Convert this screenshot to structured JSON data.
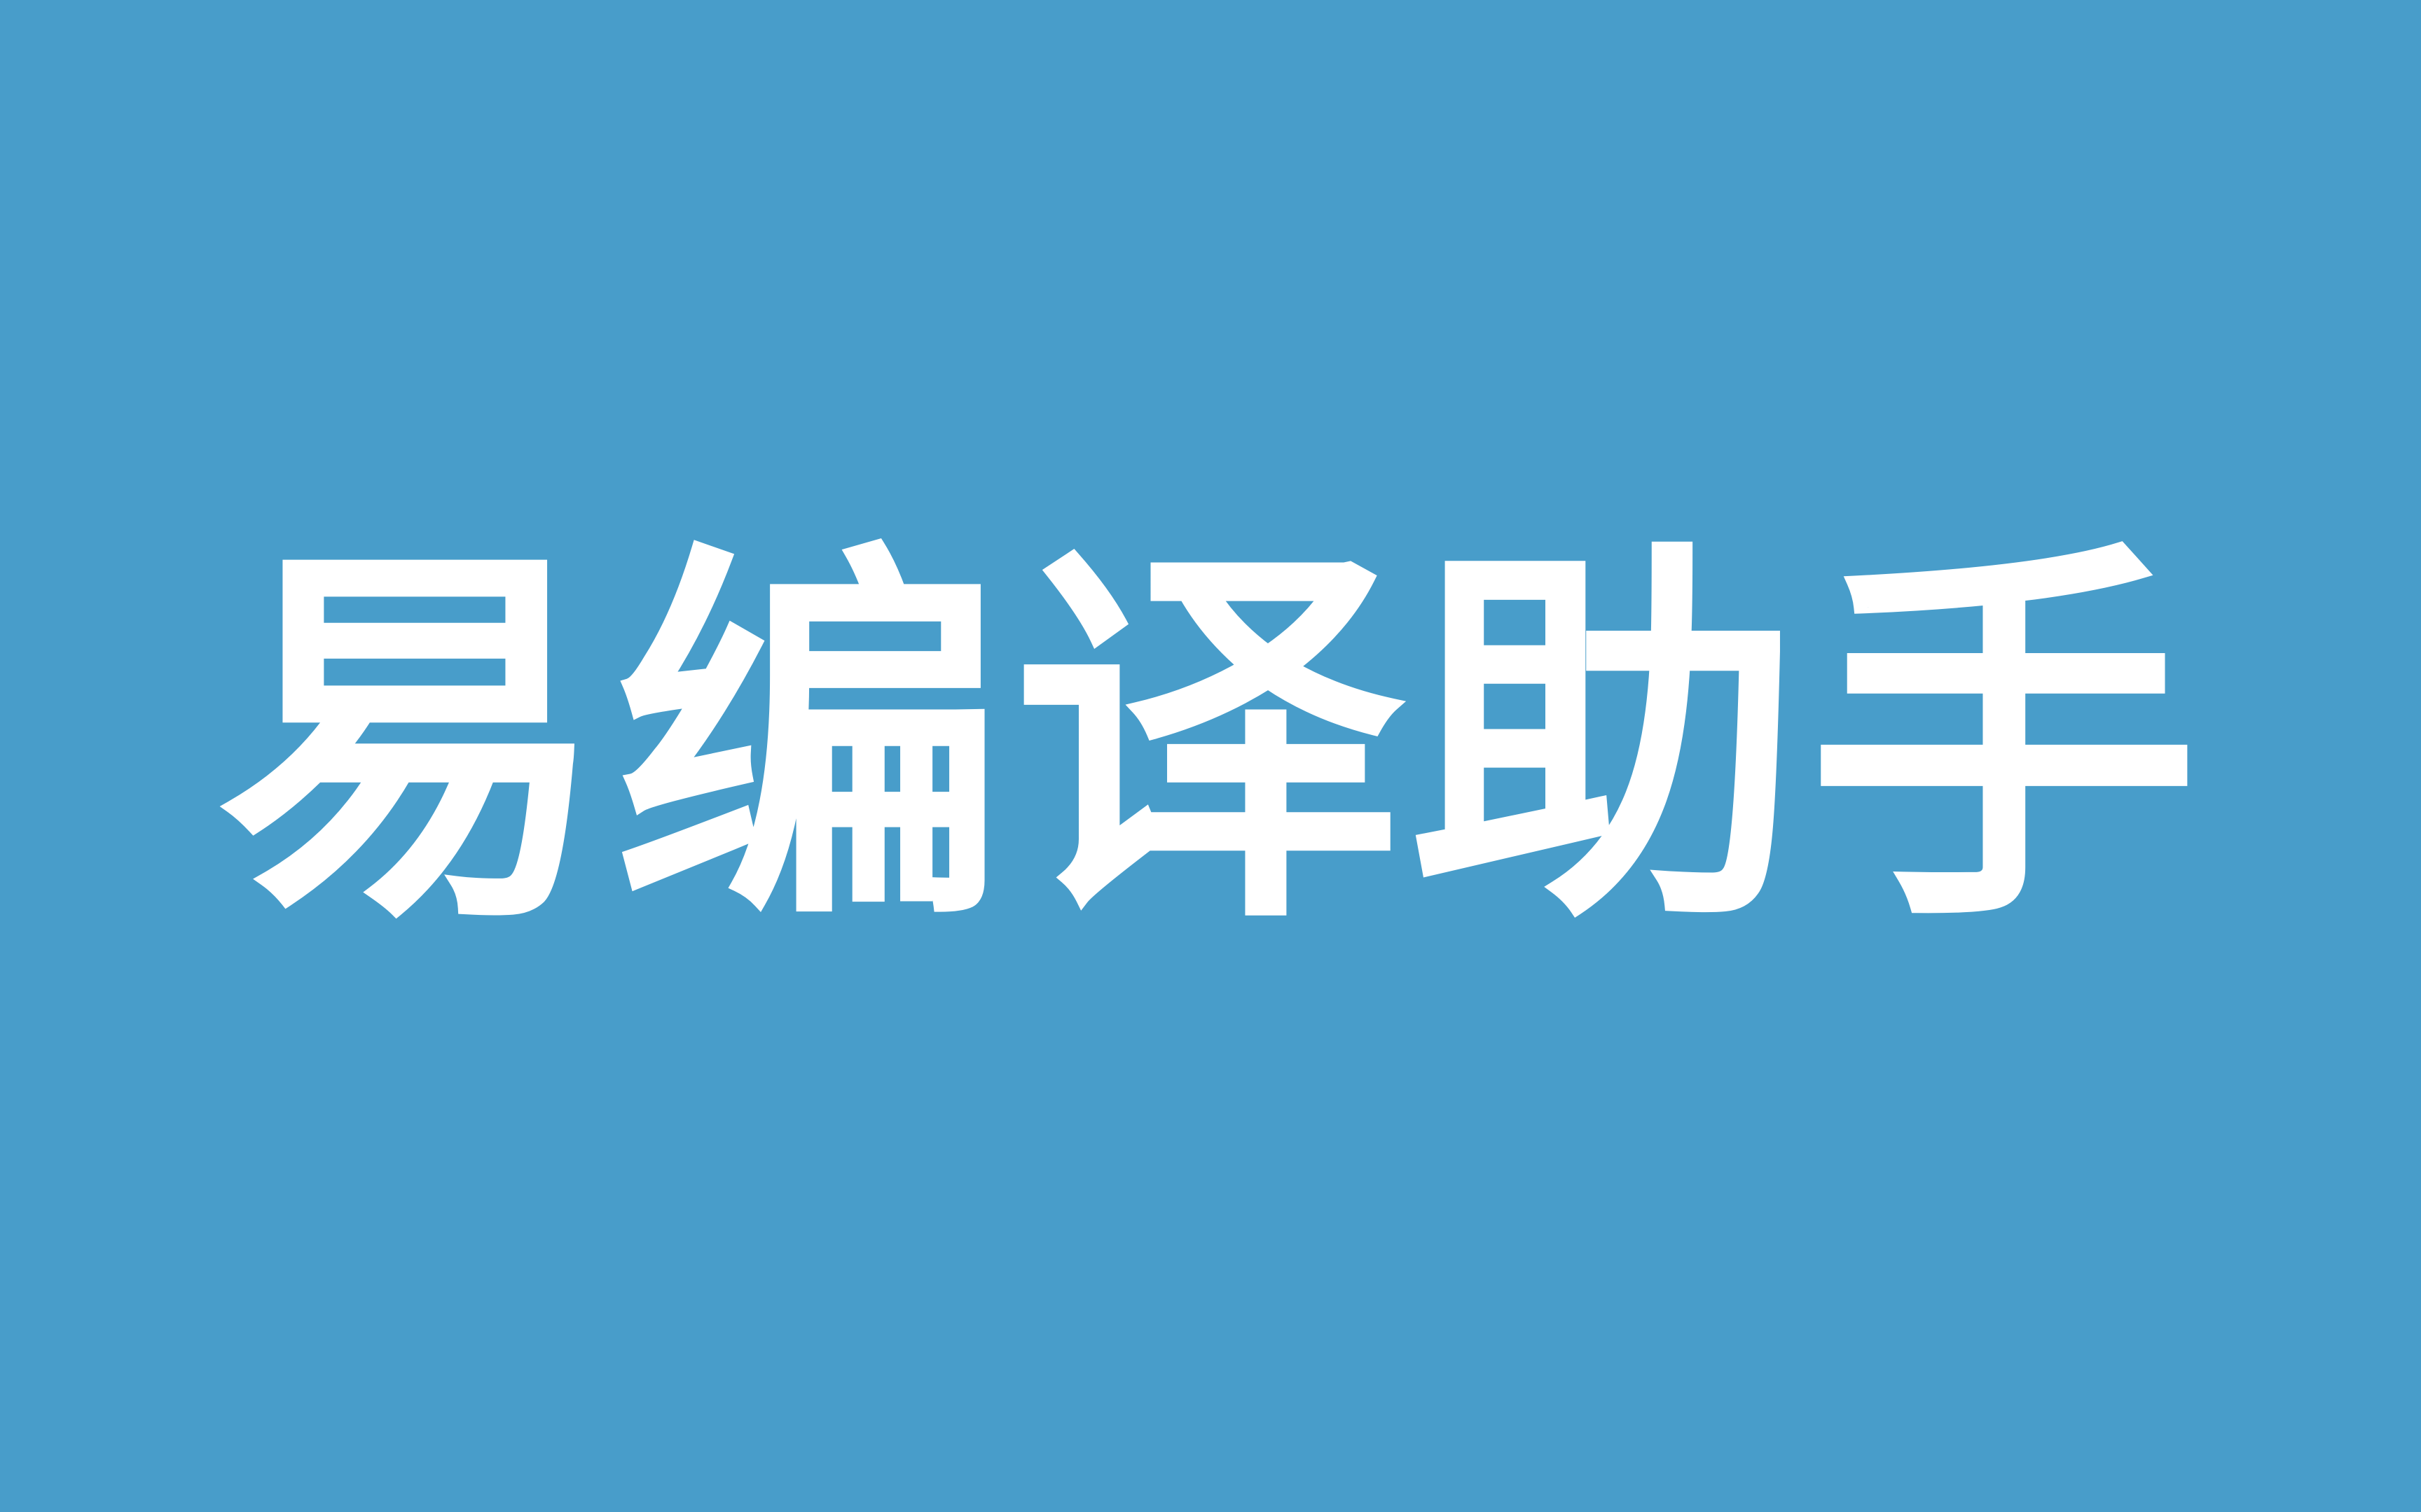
{
  "banner": {
    "title": "易编译助手",
    "background_color": "#489dca",
    "text_color": "#ffffff"
  }
}
